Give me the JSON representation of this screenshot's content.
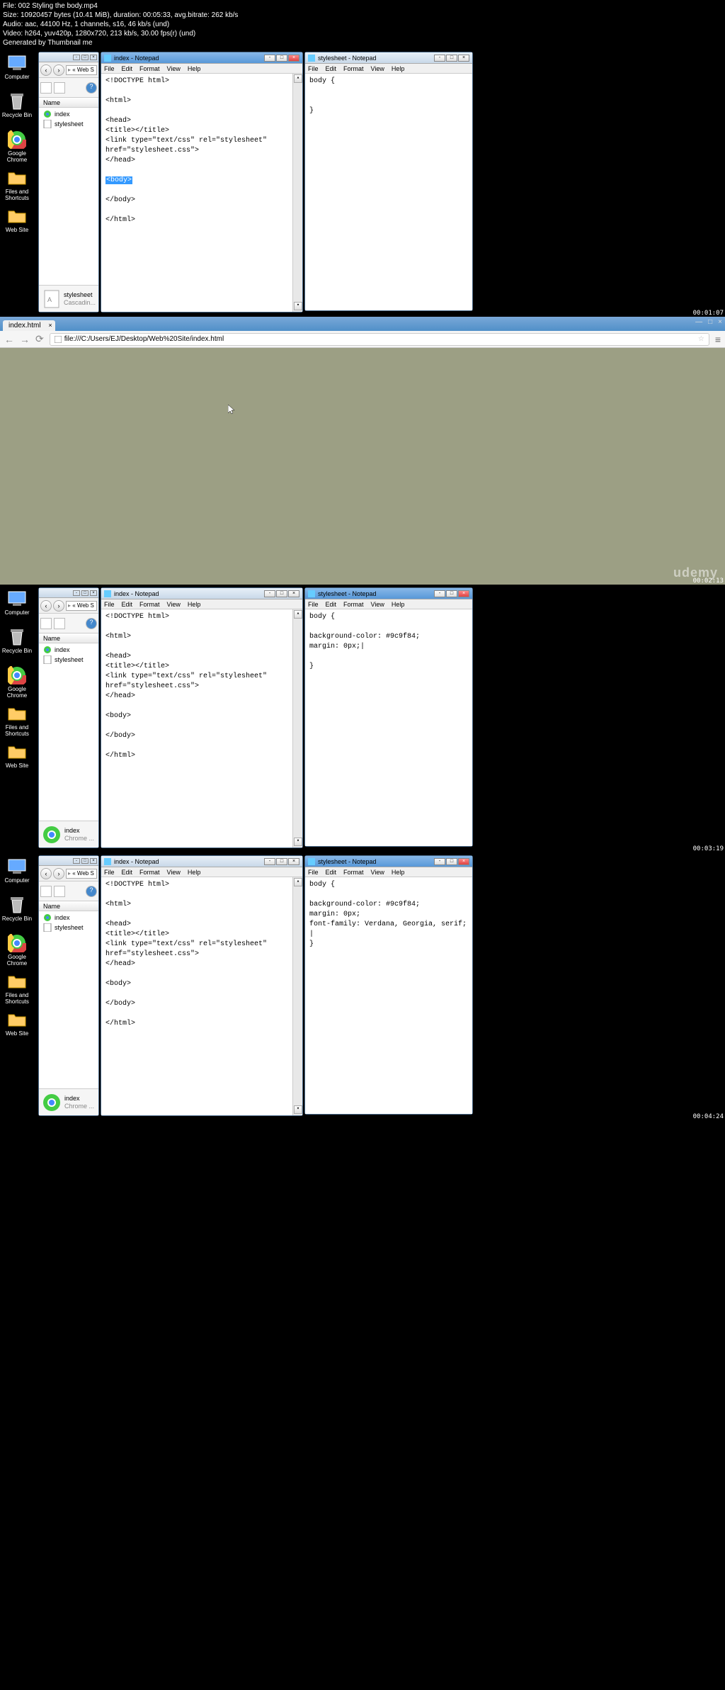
{
  "meta": {
    "file": "File: 002 Styling the body.mp4",
    "size": "Size: 10920457 bytes (10.41 MiB), duration: 00:05:33, avg.bitrate: 262 kb/s",
    "audio": "Audio: aac, 44100 Hz, 1 channels, s16, 46 kb/s (und)",
    "video": "Video: h264, yuv420p, 1280x720, 213 kb/s, 30.00 fps(r) (und)",
    "gen": "Generated by Thumbnail me"
  },
  "desktop": {
    "computer": "Computer",
    "recycle": "Recycle Bin",
    "chrome": "Google\nChrome",
    "files": "Files and\nShortcuts",
    "website": "Web Site"
  },
  "explorer": {
    "path": "« Web S",
    "col_name": "Name",
    "file_index": "index",
    "file_stylesheet": "stylesheet",
    "bot_stylesheet": "stylesheet",
    "bot_cascadin": "Cascadin...",
    "bot_index": "index",
    "bot_chrome": "Chrome ..."
  },
  "notepad_menu": {
    "file": "File",
    "edit": "Edit",
    "format": "Format",
    "view": "View",
    "help": "Help"
  },
  "frame1": {
    "np_left_title": "index - Notepad",
    "np_right_title": "stylesheet - Notepad",
    "html_code": "<!DOCTYPE html>\n\n<html>\n\n<head>\n<title></title>\n<link type=\"text/css\" rel=\"stylesheet\"\nhref=\"stylesheet.css\">\n</head>\n\n",
    "html_sel": "<body>",
    "html_after": "\n\n</body>\n\n</html>",
    "css_code": "body {\n\n\n}",
    "ts": "00:01:07"
  },
  "frame2": {
    "tab": "index.html",
    "url": "file:///C:/Users/EJ/Desktop/Web%20Site/index.html",
    "udemy": "udemy",
    "ts": "00:02:13"
  },
  "frame3": {
    "np_left_title": "index - Notepad",
    "np_right_title": "stylesheet - Notepad",
    "html_code": "<!DOCTYPE html>\n\n<html>\n\n<head>\n<title></title>\n<link type=\"text/css\" rel=\"stylesheet\"\nhref=\"stylesheet.css\">\n</head>\n\n<body>\n\n</body>\n\n</html>",
    "css_code": "body {\n\nbackground-color: #9c9f84;\nmargin: 0px;|\n\n}",
    "ts": "00:03:19"
  },
  "frame4": {
    "np_left_title": "index - Notepad",
    "np_right_title": "stylesheet - Notepad",
    "html_code": "<!DOCTYPE html>\n\n<html>\n\n<head>\n<title></title>\n<link type=\"text/css\" rel=\"stylesheet\"\nhref=\"stylesheet.css\">\n</head>\n\n<body>\n\n</body>\n\n</html>",
    "css_code": "body {\n\nbackground-color: #9c9f84;\nmargin: 0px;\nfont-family: Verdana, Georgia, serif;\n|\n}",
    "ts": "00:04:24"
  }
}
